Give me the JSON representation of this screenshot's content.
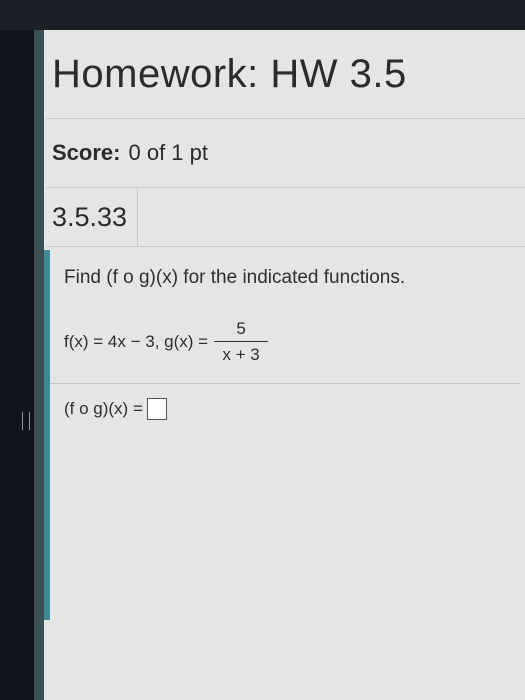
{
  "header": {
    "title": "Homework: HW 3.5"
  },
  "score": {
    "label": "Score:",
    "value": "0 of 1 pt"
  },
  "question": {
    "number": "3.5.33",
    "prompt": "Find (f o g)(x) for the indicated functions.",
    "functions_text": "f(x) = 4x − 3, g(x) =",
    "fraction_numerator": "5",
    "fraction_denominator": "x + 3",
    "answer_label": "(f o g)(x) ="
  }
}
